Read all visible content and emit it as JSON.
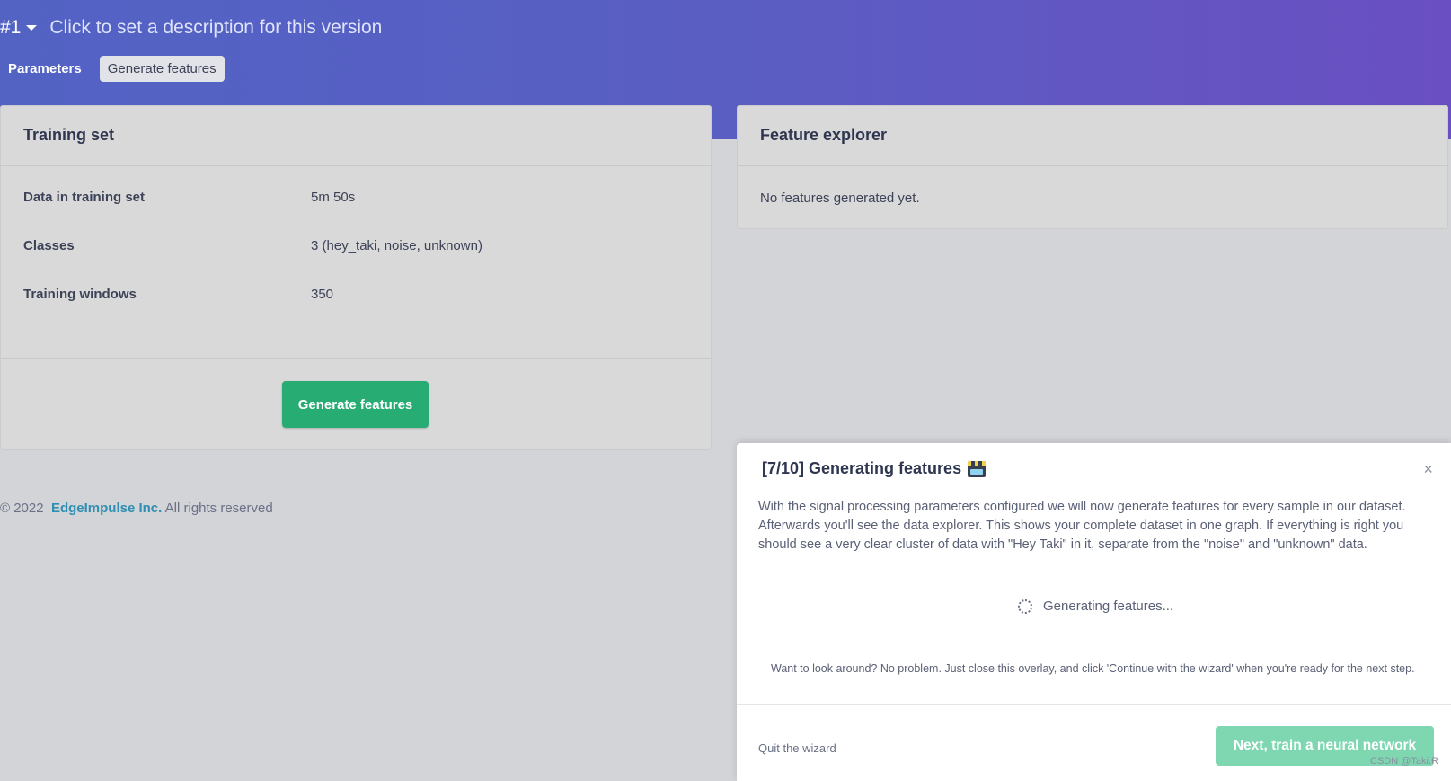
{
  "header": {
    "version": "#1",
    "description_placeholder": "Click to set a description for this version",
    "tabs": [
      "Parameters",
      "Generate features"
    ]
  },
  "training_set": {
    "title": "Training set",
    "rows": [
      {
        "label": "Data in training set",
        "value": "5m 50s"
      },
      {
        "label": "Classes",
        "value": "3 (hey_taki, noise, unknown)"
      },
      {
        "label": "Training windows",
        "value": "350"
      }
    ],
    "button": "Generate features"
  },
  "feature_explorer": {
    "title": "Feature explorer",
    "empty_text": "No features generated yet."
  },
  "footer": {
    "copyright": "© 2022",
    "brand": "EdgeImpulse Inc.",
    "rights": "All rights reserved"
  },
  "wizard": {
    "title": "[7/10] Generating features",
    "title_icon": "clapper-board-icon",
    "close": "×",
    "body": "With the signal processing parameters configured we will now generate features for every sample in our dataset. Afterwards you'll see the data explorer. This shows your complete dataset in one graph. If everything is right you should see a very clear cluster of data with \"Hey Taki\" in it, separate from the \"noise\" and \"unknown\" data.",
    "status": "Generating features...",
    "hint": "Want to look around? No problem. Just close this overlay, and click 'Continue with the wizard' when you're ready for the next step.",
    "quit": "Quit the wizard",
    "next_button": "Next, train a neural network"
  },
  "watermark": "CSDN @Taki.R",
  "colors": {
    "header_gradient_start": "#5263c4",
    "header_gradient_end": "#6a4fc2",
    "primary_green": "#27ad74",
    "disabled_green": "#7fd7b2",
    "brand_link": "#2f8fb2"
  }
}
